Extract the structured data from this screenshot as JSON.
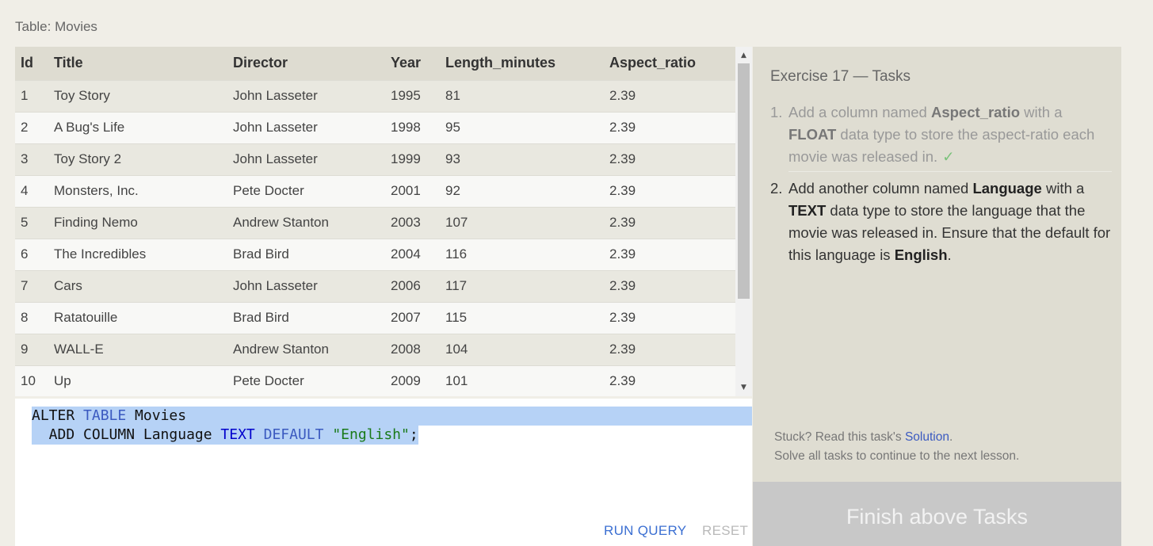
{
  "table": {
    "caption": "Table: Movies",
    "columns": [
      "Id",
      "Title",
      "Director",
      "Year",
      "Length_minutes",
      "Aspect_ratio"
    ],
    "rows": [
      [
        "1",
        "Toy Story",
        "John Lasseter",
        "1995",
        "81",
        "2.39"
      ],
      [
        "2",
        "A Bug's Life",
        "John Lasseter",
        "1998",
        "95",
        "2.39"
      ],
      [
        "3",
        "Toy Story 2",
        "John Lasseter",
        "1999",
        "93",
        "2.39"
      ],
      [
        "4",
        "Monsters, Inc.",
        "Pete Docter",
        "2001",
        "92",
        "2.39"
      ],
      [
        "5",
        "Finding Nemo",
        "Andrew Stanton",
        "2003",
        "107",
        "2.39"
      ],
      [
        "6",
        "The Incredibles",
        "Brad Bird",
        "2004",
        "116",
        "2.39"
      ],
      [
        "7",
        "Cars",
        "John Lasseter",
        "2006",
        "117",
        "2.39"
      ],
      [
        "8",
        "Ratatouille",
        "Brad Bird",
        "2007",
        "115",
        "2.39"
      ],
      [
        "9",
        "WALL-E",
        "Andrew Stanton",
        "2008",
        "104",
        "2.39"
      ],
      [
        "10",
        "Up",
        "Pete Docter",
        "2009",
        "101",
        "2.39"
      ]
    ]
  },
  "scrollbar": {
    "up_icon": "▲",
    "down_icon": "▼"
  },
  "editor": {
    "line1": {
      "t1": "ALTER ",
      "t2": "TABLE",
      "t3": " Movies"
    },
    "line2": {
      "t1": "  ADD COLUMN Language ",
      "t2": "TEXT",
      "t3": " ",
      "t4": "DEFAULT",
      "t5": " ",
      "t6": "\"English\"",
      "t7": ";"
    },
    "run_label": "RUN QUERY",
    "reset_label": "RESET"
  },
  "tasks": {
    "title": "Exercise 17 — Tasks",
    "task1": {
      "num": "1.",
      "p1": "Add a column named ",
      "b1": "Aspect_ratio",
      "p2": " with a ",
      "b2": "FLOAT",
      "p3": " data type to store the aspect-ratio each movie was released in.",
      "check": "✓"
    },
    "task2": {
      "num": "2.",
      "p1": "Add another column named ",
      "b1": "Language",
      "p2": " with a ",
      "b2": "TEXT",
      "p3": " data type to store the language that the movie was released in. Ensure that the default for this language is ",
      "b3": "English",
      "p4": "."
    },
    "stuck_prefix": "Stuck? Read this task's ",
    "solution_label": "Solution",
    "stuck_suffix": ".",
    "solve_all": "Solve all tasks to continue to the next lesson.",
    "finish_label": "Finish above Tasks"
  }
}
